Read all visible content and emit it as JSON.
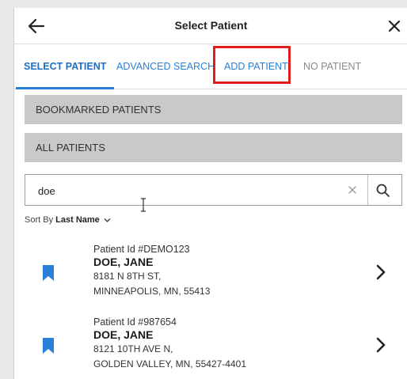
{
  "header": {
    "title": "Select Patient",
    "back_icon": "arrow-left-icon",
    "close_icon": "close-icon"
  },
  "tabs": [
    {
      "label": "SELECT PATIENT",
      "state": "active"
    },
    {
      "label": "ADVANCED SEARCH",
      "state": "link"
    },
    {
      "label": "ADD PATIENT",
      "state": "link",
      "highlighted": true
    },
    {
      "label": "NO PATIENT",
      "state": "muted"
    }
  ],
  "sections": {
    "bookmarked_label": "BOOKMARKED PATIENTS",
    "all_label": "ALL PATIENTS"
  },
  "search": {
    "value": "doe",
    "placeholder": ""
  },
  "sort": {
    "prefix": "Sort By",
    "field": "Last Name"
  },
  "patients": [
    {
      "id_label": "Patient Id #DEMO123",
      "name": "DOE, JANE",
      "address_line1": "8181 N 8TH ST,",
      "address_line2": "MINNEAPOLIS, MN, 55413",
      "bookmarked": true
    },
    {
      "id_label": "Patient Id #987654",
      "name": "DOE, JANE",
      "address_line1": "8121 10TH AVE N,",
      "address_line2": "GOLDEN VALLEY, MN, 55427-4401",
      "bookmarked": true
    }
  ],
  "colors": {
    "accent": "#2a7fd8",
    "highlight": "#e01e1e",
    "bookmark": "#2a7fd8",
    "section_bg": "#c9c9c9"
  }
}
